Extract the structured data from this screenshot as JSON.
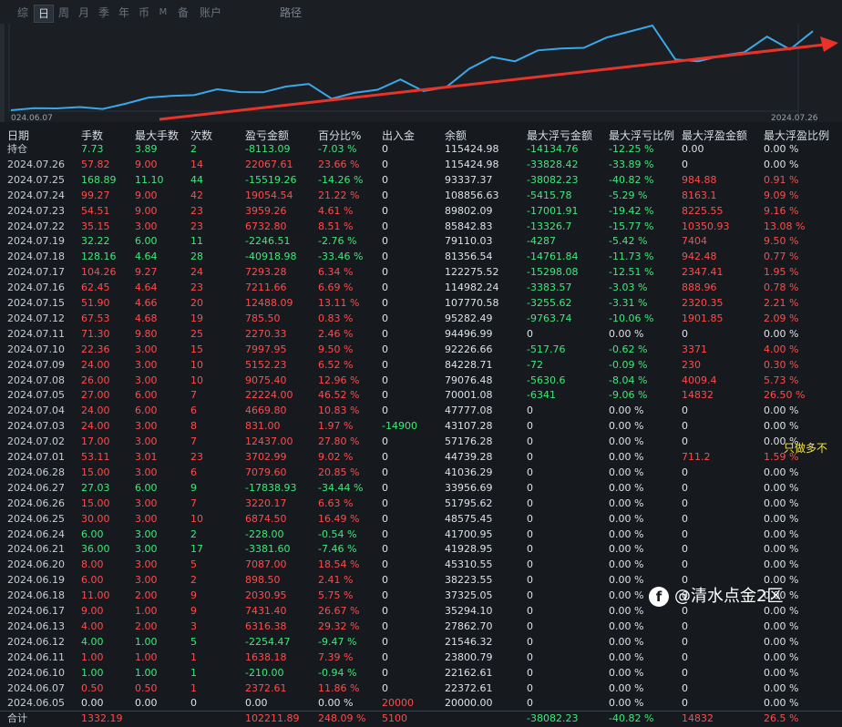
{
  "tabs": [
    "综",
    "日",
    "周",
    "月",
    "季",
    "年",
    "币",
    "M",
    "备",
    "账户",
    "路径"
  ],
  "active_tab": "日",
  "chart": {
    "start_date": "024.06.07",
    "end_date": "2024.07.26",
    "equity_curve": [
      20000,
      22372.61,
      22162.61,
      23800.79,
      21546.32,
      27862.7,
      35294.1,
      37325.05,
      38223.55,
      45310.55,
      41928.95,
      41700.95,
      48575.45,
      51795.62,
      33956.69,
      41036.29,
      44739.28,
      57176.28,
      43107.28,
      47777.08,
      70001.08,
      84228.71,
      79076.48,
      92226.66,
      94496.99,
      95282.49,
      107770.58,
      114982.24,
      122275.52,
      81356.54,
      79110.03,
      85842.83,
      89802.09,
      108856.63,
      93337.37,
      115424.98
    ],
    "trend_color": "#e8322a",
    "curve_color": "#3aa8e8"
  },
  "headers": {
    "date": "日期",
    "lots": "手数",
    "max_lots": "最大手数",
    "count": "次数",
    "pnl": "盈亏金额",
    "pct": "百分比%",
    "inout": "出入金",
    "balance": "余额",
    "max_float_loss": "最大浮亏金额",
    "max_float_loss_pct": "最大浮亏比例",
    "max_float_profit": "最大浮盈金额",
    "max_float_profit_pct": "最大浮盈比例"
  },
  "rows": [
    {
      "date": "持仓",
      "lots": "7.73",
      "max_lots": "3.89",
      "count": "2",
      "pnl": "-8113.09",
      "pct": "-7.03 %",
      "inout": "0",
      "balance": "115424.98",
      "mfl": "-14134.76",
      "mflp": "-12.25 %",
      "mfp": "0.00",
      "mfpp": "0.00 %",
      "color": "green",
      "hold": true
    },
    {
      "date": "2024.07.26",
      "lots": "57.82",
      "max_lots": "9.00",
      "count": "14",
      "pnl": "22067.61",
      "pct": "23.66 %",
      "inout": "0",
      "balance": "115424.98",
      "mfl": "-33828.42",
      "mflp": "-33.89 %",
      "mfp": "0",
      "mfpp": "0.00 %",
      "color": "red"
    },
    {
      "date": "2024.07.25",
      "lots": "168.89",
      "max_lots": "11.10",
      "count": "44",
      "pnl": "-15519.26",
      "pct": "-14.26 %",
      "inout": "0",
      "balance": "93337.37",
      "mfl": "-38082.23",
      "mflp": "-40.82 %",
      "mfp": "984.88",
      "mfpp": "0.91 %",
      "color": "green"
    },
    {
      "date": "2024.07.24",
      "lots": "99.27",
      "max_lots": "9.00",
      "count": "42",
      "pnl": "19054.54",
      "pct": "21.22 %",
      "inout": "0",
      "balance": "108856.63",
      "mfl": "-5415.78",
      "mflp": "-5.29 %",
      "mfp": "8163.1",
      "mfpp": "9.09 %",
      "color": "red"
    },
    {
      "date": "2024.07.23",
      "lots": "54.51",
      "max_lots": "9.00",
      "count": "23",
      "pnl": "3959.26",
      "pct": "4.61 %",
      "inout": "0",
      "balance": "89802.09",
      "mfl": "-17001.91",
      "mflp": "-19.42 %",
      "mfp": "8225.55",
      "mfpp": "9.16 %",
      "color": "red"
    },
    {
      "date": "2024.07.22",
      "lots": "35.15",
      "max_lots": "3.00",
      "count": "23",
      "pnl": "6732.80",
      "pct": "8.51 %",
      "inout": "0",
      "balance": "85842.83",
      "mfl": "-13326.7",
      "mflp": "-15.77 %",
      "mfp": "10350.93",
      "mfpp": "13.08 %",
      "color": "red"
    },
    {
      "date": "2024.07.19",
      "lots": "32.22",
      "max_lots": "6.00",
      "count": "11",
      "pnl": "-2246.51",
      "pct": "-2.76 %",
      "inout": "0",
      "balance": "79110.03",
      "mfl": "-4287",
      "mflp": "-5.42 %",
      "mfp": "7404",
      "mfpp": "9.50 %",
      "color": "green"
    },
    {
      "date": "2024.07.18",
      "lots": "128.16",
      "max_lots": "4.64",
      "count": "28",
      "pnl": "-40918.98",
      "pct": "-33.46 %",
      "inout": "0",
      "balance": "81356.54",
      "mfl": "-14761.84",
      "mflp": "-11.73 %",
      "mfp": "942.48",
      "mfpp": "0.77 %",
      "color": "green"
    },
    {
      "date": "2024.07.17",
      "lots": "104.26",
      "max_lots": "9.27",
      "count": "24",
      "pnl": "7293.28",
      "pct": "6.34 %",
      "inout": "0",
      "balance": "122275.52",
      "mfl": "-15298.08",
      "mflp": "-12.51 %",
      "mfp": "2347.41",
      "mfpp": "1.95 %",
      "color": "red"
    },
    {
      "date": "2024.07.16",
      "lots": "62.45",
      "max_lots": "4.64",
      "count": "23",
      "pnl": "7211.66",
      "pct": "6.69 %",
      "inout": "0",
      "balance": "114982.24",
      "mfl": "-3383.57",
      "mflp": "-3.03 %",
      "mfp": "888.96",
      "mfpp": "0.78 %",
      "color": "red"
    },
    {
      "date": "2024.07.15",
      "lots": "51.90",
      "max_lots": "4.66",
      "count": "20",
      "pnl": "12488.09",
      "pct": "13.11 %",
      "inout": "0",
      "balance": "107770.58",
      "mfl": "-3255.62",
      "mflp": "-3.31 %",
      "mfp": "2320.35",
      "mfpp": "2.21 %",
      "color": "red"
    },
    {
      "date": "2024.07.12",
      "lots": "67.53",
      "max_lots": "4.68",
      "count": "19",
      "pnl": "785.50",
      "pct": "0.83 %",
      "inout": "0",
      "balance": "95282.49",
      "mfl": "-9763.74",
      "mflp": "-10.06 %",
      "mfp": "1901.85",
      "mfpp": "2.09 %",
      "color": "red"
    },
    {
      "date": "2024.07.11",
      "lots": "71.30",
      "max_lots": "9.80",
      "count": "25",
      "pnl": "2270.33",
      "pct": "2.46 %",
      "inout": "0",
      "balance": "94496.99",
      "mfl": "0",
      "mflp": "0.00 %",
      "mfp": "0",
      "mfpp": "0.00 %",
      "color": "red"
    },
    {
      "date": "2024.07.10",
      "lots": "22.36",
      "max_lots": "3.00",
      "count": "15",
      "pnl": "7997.95",
      "pct": "9.50 %",
      "inout": "0",
      "balance": "92226.66",
      "mfl": "-517.76",
      "mflp": "-0.62 %",
      "mfp": "3371",
      "mfpp": "4.00 %",
      "color": "red"
    },
    {
      "date": "2024.07.09",
      "lots": "24.00",
      "max_lots": "3.00",
      "count": "10",
      "pnl": "5152.23",
      "pct": "6.52 %",
      "inout": "0",
      "balance": "84228.71",
      "mfl": "-72",
      "mflp": "-0.09 %",
      "mfp": "230",
      "mfpp": "0.30 %",
      "color": "red"
    },
    {
      "date": "2024.07.08",
      "lots": "26.00",
      "max_lots": "3.00",
      "count": "10",
      "pnl": "9075.40",
      "pct": "12.96 %",
      "inout": "0",
      "balance": "79076.48",
      "mfl": "-5630.6",
      "mflp": "-8.04 %",
      "mfp": "4009.4",
      "mfpp": "5.73 %",
      "color": "red"
    },
    {
      "date": "2024.07.05",
      "lots": "27.00",
      "max_lots": "6.00",
      "count": "7",
      "pnl": "22224.00",
      "pct": "46.52 %",
      "inout": "0",
      "balance": "70001.08",
      "mfl": "-6341",
      "mflp": "-9.06 %",
      "mfp": "14832",
      "mfpp": "26.50 %",
      "color": "red"
    },
    {
      "date": "2024.07.04",
      "lots": "24.00",
      "max_lots": "6.00",
      "count": "6",
      "pnl": "4669.80",
      "pct": "10.83 %",
      "inout": "0",
      "balance": "47777.08",
      "mfl": "0",
      "mflp": "0.00 %",
      "mfp": "0",
      "mfpp": "0.00 %",
      "color": "red"
    },
    {
      "date": "2024.07.03",
      "lots": "24.00",
      "max_lots": "3.00",
      "count": "8",
      "pnl": "831.00",
      "pct": "1.97 %",
      "inout": "-14900",
      "balance": "43107.28",
      "mfl": "0",
      "mflp": "0.00 %",
      "mfp": "0",
      "mfpp": "0.00 %",
      "color": "red"
    },
    {
      "date": "2024.07.02",
      "lots": "17.00",
      "max_lots": "3.00",
      "count": "7",
      "pnl": "12437.00",
      "pct": "27.80 %",
      "inout": "0",
      "balance": "57176.28",
      "mfl": "0",
      "mflp": "0.00 %",
      "mfp": "0",
      "mfpp": "0.00 %",
      "color": "red"
    },
    {
      "date": "2024.07.01",
      "lots": "53.11",
      "max_lots": "3.01",
      "count": "23",
      "pnl": "3702.99",
      "pct": "9.02 %",
      "inout": "0",
      "balance": "44739.28",
      "mfl": "0",
      "mflp": "0.00 %",
      "mfp": "711.2",
      "mfpp": "1.59 %",
      "color": "red"
    },
    {
      "date": "2024.06.28",
      "lots": "15.00",
      "max_lots": "3.00",
      "count": "6",
      "pnl": "7079.60",
      "pct": "20.85 %",
      "inout": "0",
      "balance": "41036.29",
      "mfl": "0",
      "mflp": "0.00 %",
      "mfp": "0",
      "mfpp": "0.00 %",
      "color": "red"
    },
    {
      "date": "2024.06.27",
      "lots": "27.03",
      "max_lots": "6.00",
      "count": "9",
      "pnl": "-17838.93",
      "pct": "-34.44 %",
      "inout": "0",
      "balance": "33956.69",
      "mfl": "0",
      "mflp": "0.00 %",
      "mfp": "0",
      "mfpp": "0.00 %",
      "color": "green"
    },
    {
      "date": "2024.06.26",
      "lots": "15.00",
      "max_lots": "3.00",
      "count": "7",
      "pnl": "3220.17",
      "pct": "6.63 %",
      "inout": "0",
      "balance": "51795.62",
      "mfl": "0",
      "mflp": "0.00 %",
      "mfp": "0",
      "mfpp": "0.00 %",
      "color": "red"
    },
    {
      "date": "2024.06.25",
      "lots": "30.00",
      "max_lots": "3.00",
      "count": "10",
      "pnl": "6874.50",
      "pct": "16.49 %",
      "inout": "0",
      "balance": "48575.45",
      "mfl": "0",
      "mflp": "0.00 %",
      "mfp": "0",
      "mfpp": "0.00 %",
      "color": "red"
    },
    {
      "date": "2024.06.24",
      "lots": "6.00",
      "max_lots": "3.00",
      "count": "2",
      "pnl": "-228.00",
      "pct": "-0.54 %",
      "inout": "0",
      "balance": "41700.95",
      "mfl": "0",
      "mflp": "0.00 %",
      "mfp": "0",
      "mfpp": "0.00 %",
      "color": "green"
    },
    {
      "date": "2024.06.21",
      "lots": "36.00",
      "max_lots": "3.00",
      "count": "17",
      "pnl": "-3381.60",
      "pct": "-7.46 %",
      "inout": "0",
      "balance": "41928.95",
      "mfl": "0",
      "mflp": "0.00 %",
      "mfp": "0",
      "mfpp": "0.00 %",
      "color": "green"
    },
    {
      "date": "2024.06.20",
      "lots": "8.00",
      "max_lots": "3.00",
      "count": "5",
      "pnl": "7087.00",
      "pct": "18.54 %",
      "inout": "0",
      "balance": "45310.55",
      "mfl": "0",
      "mflp": "0.00 %",
      "mfp": "0",
      "mfpp": "0.00 %",
      "color": "red"
    },
    {
      "date": "2024.06.19",
      "lots": "6.00",
      "max_lots": "3.00",
      "count": "2",
      "pnl": "898.50",
      "pct": "2.41 %",
      "inout": "0",
      "balance": "38223.55",
      "mfl": "0",
      "mflp": "0.00 %",
      "mfp": "0",
      "mfpp": "0.00 %",
      "color": "red"
    },
    {
      "date": "2024.06.18",
      "lots": "11.00",
      "max_lots": "2.00",
      "count": "9",
      "pnl": "2030.95",
      "pct": "5.75 %",
      "inout": "0",
      "balance": "37325.05",
      "mfl": "0",
      "mflp": "0.00 %",
      "mfp": "0",
      "mfpp": "0.00 %",
      "color": "red"
    },
    {
      "date": "2024.06.17",
      "lots": "9.00",
      "max_lots": "1.00",
      "count": "9",
      "pnl": "7431.40",
      "pct": "26.67 %",
      "inout": "0",
      "balance": "35294.10",
      "mfl": "0",
      "mflp": "0.00 %",
      "mfp": "0",
      "mfpp": "0.00 %",
      "color": "red"
    },
    {
      "date": "2024.06.13",
      "lots": "4.00",
      "max_lots": "2.00",
      "count": "3",
      "pnl": "6316.38",
      "pct": "29.32 %",
      "inout": "0",
      "balance": "27862.70",
      "mfl": "0",
      "mflp": "0.00 %",
      "mfp": "0",
      "mfpp": "0.00 %",
      "color": "red"
    },
    {
      "date": "2024.06.12",
      "lots": "4.00",
      "max_lots": "1.00",
      "count": "5",
      "pnl": "-2254.47",
      "pct": "-9.47 %",
      "inout": "0",
      "balance": "21546.32",
      "mfl": "0",
      "mflp": "0.00 %",
      "mfp": "0",
      "mfpp": "0.00 %",
      "color": "green"
    },
    {
      "date": "2024.06.11",
      "lots": "1.00",
      "max_lots": "1.00",
      "count": "1",
      "pnl": "1638.18",
      "pct": "7.39 %",
      "inout": "0",
      "balance": "23800.79",
      "mfl": "0",
      "mflp": "0.00 %",
      "mfp": "0",
      "mfpp": "0.00 %",
      "color": "red"
    },
    {
      "date": "2024.06.10",
      "lots": "1.00",
      "max_lots": "1.00",
      "count": "1",
      "pnl": "-210.00",
      "pct": "-0.94 %",
      "inout": "0",
      "balance": "22162.61",
      "mfl": "0",
      "mflp": "0.00 %",
      "mfp": "0",
      "mfpp": "0.00 %",
      "color": "green"
    },
    {
      "date": "2024.06.07",
      "lots": "0.50",
      "max_lots": "0.50",
      "count": "1",
      "pnl": "2372.61",
      "pct": "11.86 %",
      "inout": "0",
      "balance": "22372.61",
      "mfl": "0",
      "mflp": "0.00 %",
      "mfp": "0",
      "mfpp": "0.00 %",
      "color": "red"
    },
    {
      "date": "2024.06.05",
      "lots": "0.00",
      "max_lots": "0.00",
      "count": "0",
      "pnl": "0.00",
      "pct": "0.00 %",
      "inout": "20000",
      "balance": "20000.00",
      "mfl": "0",
      "mflp": "0.00 %",
      "mfp": "0",
      "mfpp": "0.00 %",
      "color": "white",
      "inoutRed": true
    }
  ],
  "totals": {
    "date": "合计",
    "lots": "1332.19",
    "max_lots": "",
    "count": "",
    "pnl": "102211.89",
    "pct": "248.09 %",
    "inout": "5100",
    "balance": "",
    "mfl": "-38082.23",
    "mflp": "-40.82 %",
    "mfp": "14832",
    "mfpp": "26.5 %"
  },
  "side_note": "只做多不",
  "watermark": "@清水点金2区",
  "watermark_icon": "f"
}
